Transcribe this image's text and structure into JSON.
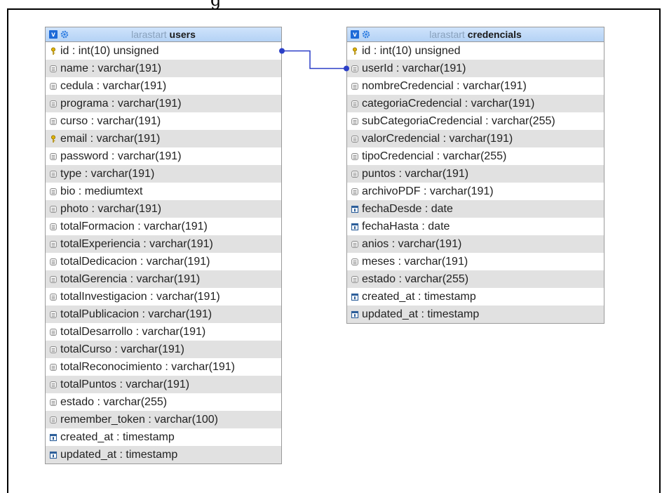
{
  "heading_fragment": "g",
  "tables": [
    {
      "db": "larastart",
      "name": "users",
      "columns": [
        {
          "icon": "key-icon",
          "text": "id : int(10) unsigned"
        },
        {
          "icon": "column-icon",
          "text": "name : varchar(191)"
        },
        {
          "icon": "column-icon",
          "text": "cedula : varchar(191)"
        },
        {
          "icon": "column-icon",
          "text": "programa : varchar(191)"
        },
        {
          "icon": "column-icon",
          "text": "curso : varchar(191)"
        },
        {
          "icon": "key-icon",
          "text": "email : varchar(191)"
        },
        {
          "icon": "column-icon",
          "text": "password : varchar(191)"
        },
        {
          "icon": "column-icon",
          "text": "type : varchar(191)"
        },
        {
          "icon": "column-icon",
          "text": "bio : mediumtext"
        },
        {
          "icon": "column-icon",
          "text": "photo : varchar(191)"
        },
        {
          "icon": "column-icon",
          "text": "totalFormacion : varchar(191)"
        },
        {
          "icon": "column-icon",
          "text": "totalExperiencia : varchar(191)"
        },
        {
          "icon": "column-icon",
          "text": "totalDedicacion : varchar(191)"
        },
        {
          "icon": "column-icon",
          "text": "totalGerencia : varchar(191)"
        },
        {
          "icon": "column-icon",
          "text": "totalInvestigacion : varchar(191)"
        },
        {
          "icon": "column-icon",
          "text": "totalPublicacion : varchar(191)"
        },
        {
          "icon": "column-icon",
          "text": "totalDesarrollo : varchar(191)"
        },
        {
          "icon": "column-icon",
          "text": "totalCurso : varchar(191)"
        },
        {
          "icon": "column-icon",
          "text": "totalReconocimiento : varchar(191)"
        },
        {
          "icon": "column-icon",
          "text": "totalPuntos : varchar(191)"
        },
        {
          "icon": "column-icon",
          "text": "estado : varchar(255)"
        },
        {
          "icon": "column-icon",
          "text": "remember_token : varchar(100)"
        },
        {
          "icon": "date-icon",
          "text": "created_at : timestamp"
        },
        {
          "icon": "date-icon",
          "text": "updated_at : timestamp"
        }
      ]
    },
    {
      "db": "larastart",
      "name": "credencials",
      "columns": [
        {
          "icon": "key-icon",
          "text": "id : int(10) unsigned"
        },
        {
          "icon": "column-icon",
          "text": "userId : varchar(191)"
        },
        {
          "icon": "column-icon",
          "text": "nombreCredencial : varchar(191)"
        },
        {
          "icon": "column-icon",
          "text": "categoriaCredencial : varchar(191)"
        },
        {
          "icon": "column-icon",
          "text": "subCategoriaCredencial : varchar(255)"
        },
        {
          "icon": "column-icon",
          "text": "valorCredencial : varchar(191)"
        },
        {
          "icon": "column-icon",
          "text": "tipoCredencial : varchar(255)"
        },
        {
          "icon": "column-icon",
          "text": "puntos : varchar(191)"
        },
        {
          "icon": "column-icon",
          "text": "archivoPDF : varchar(191)"
        },
        {
          "icon": "date-icon",
          "text": "fechaDesde : date"
        },
        {
          "icon": "date-icon",
          "text": "fechaHasta : date"
        },
        {
          "icon": "column-icon",
          "text": "anios : varchar(191)"
        },
        {
          "icon": "column-icon",
          "text": "meses : varchar(191)"
        },
        {
          "icon": "column-icon",
          "text": "estado : varchar(255)"
        },
        {
          "icon": "date-icon",
          "text": "created_at : timestamp"
        },
        {
          "icon": "date-icon",
          "text": "updated_at : timestamp"
        }
      ]
    }
  ],
  "relation": {
    "from_table": "users",
    "from_column": "id",
    "to_table": "credencials",
    "to_column": "userId",
    "color": "#2b3fc7"
  }
}
